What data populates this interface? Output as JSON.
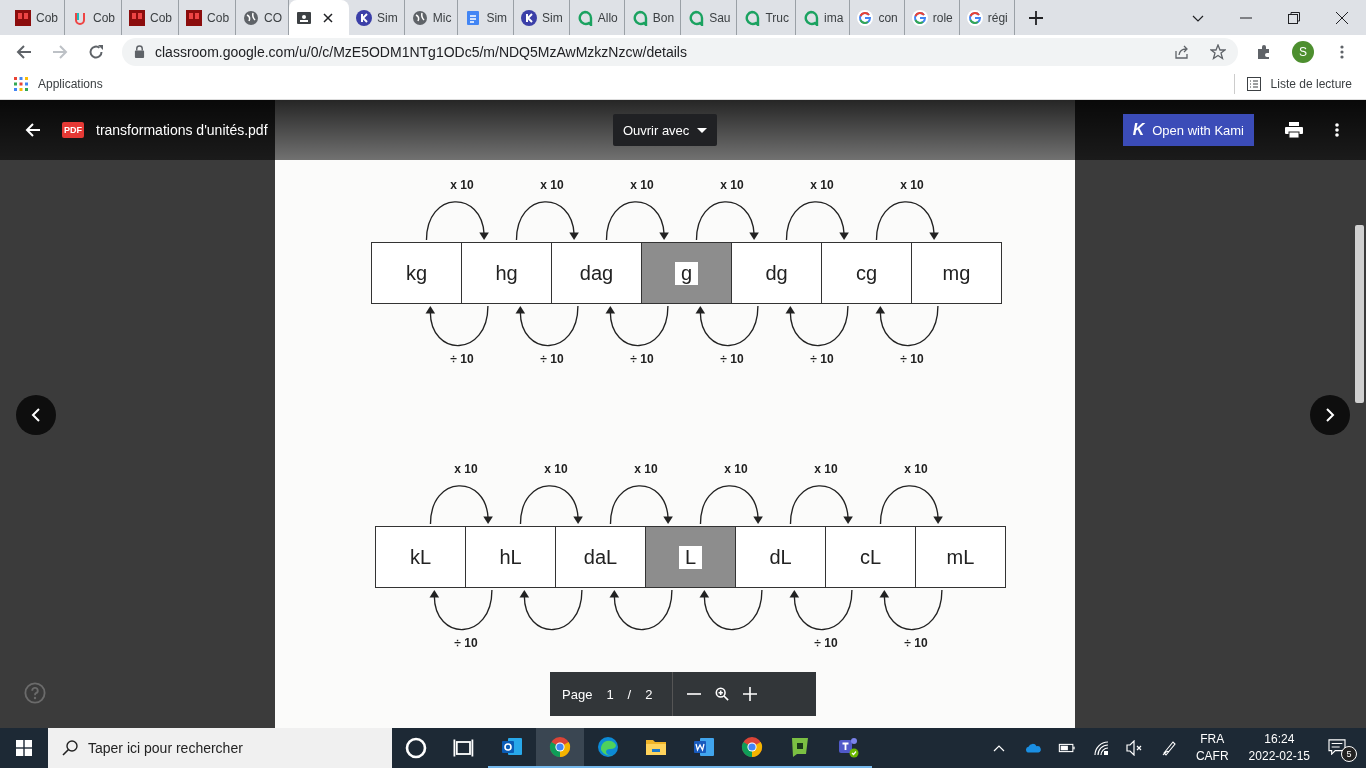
{
  "browser": {
    "tabs": [
      {
        "kind": "red",
        "label": "Cob",
        "selected": false
      },
      {
        "kind": "hook",
        "label": "Cob",
        "selected": false
      },
      {
        "kind": "red",
        "label": "Cob",
        "selected": false
      },
      {
        "kind": "red",
        "label": "Cob",
        "selected": false
      },
      {
        "kind": "globe",
        "label": "CO",
        "selected": false
      },
      {
        "kind": "classroom",
        "selected": true
      },
      {
        "kind": "kami",
        "label": "Sim",
        "selected": false
      },
      {
        "kind": "globe",
        "label": "Mic",
        "selected": false
      },
      {
        "kind": "docs",
        "label": "Sim",
        "selected": false
      },
      {
        "kind": "kami",
        "label": "Sim",
        "selected": false
      },
      {
        "kind": "bubble",
        "label": "Allo",
        "selected": false
      },
      {
        "kind": "bubble",
        "label": "Bon",
        "selected": false
      },
      {
        "kind": "bubble",
        "label": "Sau",
        "selected": false
      },
      {
        "kind": "bubble",
        "label": "Truc",
        "selected": false
      },
      {
        "kind": "bubble",
        "label": "ima",
        "selected": false
      },
      {
        "kind": "google",
        "label": "con",
        "selected": false
      },
      {
        "kind": "google",
        "label": "role",
        "selected": false
      },
      {
        "kind": "google",
        "label": "régi",
        "selected": false
      }
    ],
    "url": "classroom.google.com/u/0/c/MzE5ODM1NTg1ODc5/m/NDQ5MzAwMzkzNzcw/details",
    "forward_disabled": true,
    "profile_initial": "S",
    "bookmarks": {
      "apps_label": "Applications",
      "reading_list": "Liste de lecture"
    }
  },
  "viewer": {
    "pdf_badge": "PDF",
    "file_name": "transformations d'unités.pdf",
    "open_with": "Ouvrir avec",
    "kami_logo": "K",
    "kami_button": "Open with Kami",
    "diagrams": [
      {
        "units": [
          {
            "label": "kg",
            "selected": false
          },
          {
            "label": "hg",
            "selected": false
          },
          {
            "label": "dag",
            "selected": false
          },
          {
            "label": "g",
            "selected": true
          },
          {
            "label": "dg",
            "selected": false
          },
          {
            "label": "cg",
            "selected": false
          },
          {
            "label": "mg",
            "selected": false
          }
        ],
        "steps": [
          {
            "multiply_label": "x 10",
            "divide_label": "÷ 10"
          },
          {
            "multiply_label": "x 10",
            "divide_label": "÷ 10"
          },
          {
            "multiply_label": "x 10",
            "divide_label": "÷ 10"
          },
          {
            "multiply_label": "x 10",
            "divide_label": "÷ 10"
          },
          {
            "multiply_label": "x 10",
            "divide_label": "÷ 10"
          },
          {
            "multiply_label": "x 10",
            "divide_label": "÷ 10"
          }
        ]
      },
      {
        "units": [
          {
            "label": "kL",
            "selected": false
          },
          {
            "label": "hL",
            "selected": false
          },
          {
            "label": "daL",
            "selected": false
          },
          {
            "label": "L",
            "selected": true
          },
          {
            "label": "dL",
            "selected": false
          },
          {
            "label": "cL",
            "selected": false
          },
          {
            "label": "mL",
            "selected": false
          }
        ],
        "steps": [
          {
            "multiply_label": "x 10",
            "divide_label": "÷ 10"
          },
          {
            "multiply_label": "x 10"
          },
          {
            "multiply_label": "x 10"
          },
          {
            "multiply_label": "x 10"
          },
          {
            "multiply_label": "x 10",
            "divide_label": "÷ 10"
          },
          {
            "multiply_label": "x 10",
            "divide_label": "÷ 10"
          }
        ]
      }
    ],
    "page_control": {
      "label": "Page",
      "current": "1",
      "separator": "/",
      "total": "2"
    }
  },
  "taskbar": {
    "search_placeholder": "Taper ici pour rechercher",
    "apps": [
      {
        "kind": "outlook",
        "selected": false
      },
      {
        "kind": "chrome",
        "selected": true
      },
      {
        "kind": "edge",
        "selected": false
      },
      {
        "kind": "folder",
        "selected": false
      },
      {
        "kind": "word",
        "selected": false
      },
      {
        "kind": "chrome",
        "selected": false
      },
      {
        "kind": "green",
        "selected": false
      },
      {
        "kind": "teams",
        "selected": false
      }
    ],
    "language": "FRA",
    "layout": "CAFR",
    "time": "16:24",
    "date": "2022-02-15",
    "notifications": "5"
  }
}
